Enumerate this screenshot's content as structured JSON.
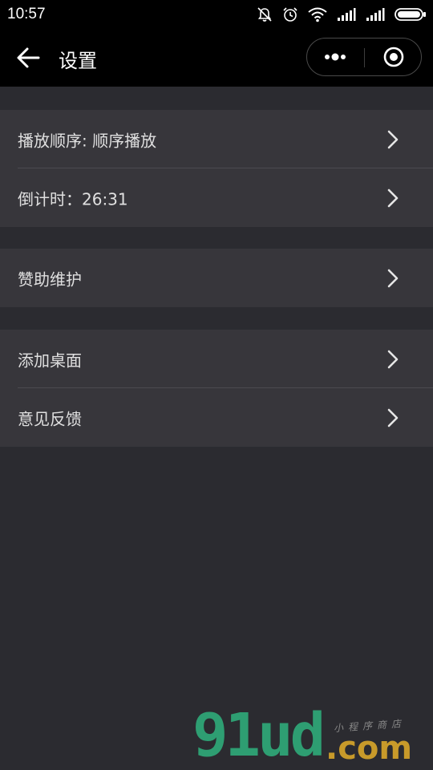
{
  "status_bar": {
    "time": "10:57",
    "icons": [
      "mute-bell-icon",
      "alarm-icon",
      "wifi-icon",
      "signal-icon",
      "signal-icon",
      "battery-icon"
    ]
  },
  "nav": {
    "title": "设置",
    "back_icon": "arrow-left-icon",
    "more_icon": "more-dots-icon",
    "close_icon": "target-circle-icon"
  },
  "groups": [
    {
      "items": [
        {
          "label": "播放顺序: 顺序播放"
        },
        {
          "label": "倒计时：26:31"
        }
      ]
    },
    {
      "items": [
        {
          "label": "赞助维护"
        }
      ]
    },
    {
      "items": [
        {
          "label": "添加桌面"
        },
        {
          "label": "意见反馈"
        }
      ]
    }
  ],
  "watermark": {
    "brand": "91ud",
    "domain": ".com",
    "tagline": "小程序商店"
  },
  "colors": {
    "background": "#2b2b30",
    "cell": "#37363b",
    "bar": "#000000",
    "watermark_green": "#2e9e72",
    "watermark_gold": "#c89a2a"
  }
}
